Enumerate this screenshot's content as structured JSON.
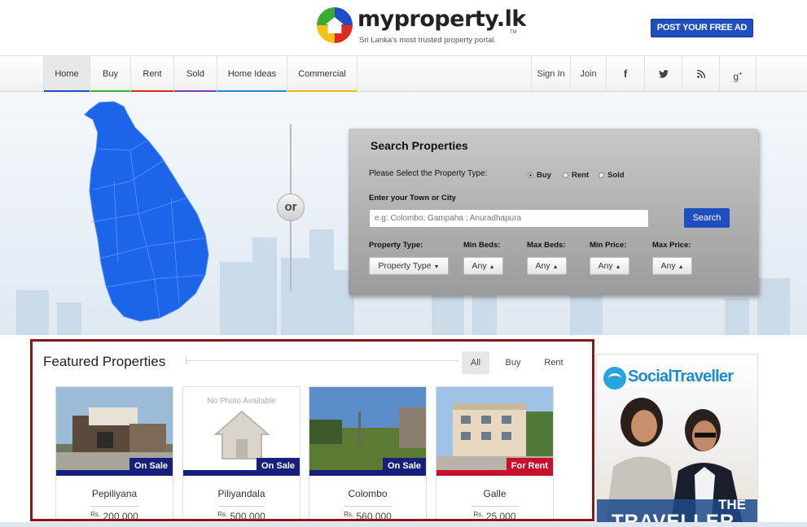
{
  "header": {
    "logo_text": "myproperty.lk",
    "logo_tm": "TM",
    "tagline": "Sri Lanka's most trusted property portal.",
    "post_ad_label": "POST YOUR FREE AD"
  },
  "nav": {
    "items": [
      {
        "label": "Home",
        "accent": "#1f4fbf"
      },
      {
        "label": "Buy",
        "accent": "#2bb24c"
      },
      {
        "label": "Rent",
        "accent": "#e02a1f"
      },
      {
        "label": "Sold",
        "accent": "#7b3fb5"
      },
      {
        "label": "Home Ideas",
        "accent": "#1f8fd4"
      },
      {
        "label": "Commercial",
        "accent": "#f2b41a"
      }
    ],
    "sign_in": "Sign In",
    "join": "Join",
    "social_icons": [
      "facebook-icon",
      "twitter-icon",
      "rss-icon",
      "google-plus-icon"
    ]
  },
  "hero": {
    "or_label": "or",
    "map_color": "#1c64ea"
  },
  "search": {
    "title": "Search Properties",
    "type_prompt": "Please Select the Property Type:",
    "options": [
      "Buy",
      "Rent",
      "Sold"
    ],
    "selected_option": "Buy",
    "town_label": "Enter your Town or City",
    "town_placeholder": "e.g: Colombo; Gampaha ; Anuradhapura",
    "search_button": "Search",
    "filters": [
      {
        "label": "Property Type:",
        "value": "Property Type"
      },
      {
        "label": "Min Beds:",
        "value": "Any"
      },
      {
        "label": "Max Beds:",
        "value": "Any"
      },
      {
        "label": "Min Price:",
        "value": "Any"
      },
      {
        "label": "Max Price:",
        "value": "Any"
      }
    ]
  },
  "featured": {
    "title": "Featured Properties",
    "tabs": [
      "All",
      "Buy",
      "Rent"
    ],
    "active_tab": "All",
    "no_photo_text": "No Photo Available",
    "cards": [
      {
        "location": "Pepiliyana",
        "badge": "On Sale",
        "badge_color": "#14207a",
        "currency": "Rs.",
        "price": "200,000"
      },
      {
        "location": "Piliyandala",
        "badge": "On Sale",
        "badge_color": "#14207a",
        "currency": "Rs.",
        "price": "500,000"
      },
      {
        "location": "Colombo",
        "badge": "On Sale",
        "badge_color": "#14207a",
        "currency": "Rs.",
        "price": "560,000"
      },
      {
        "location": "Galle",
        "badge": "For Rent",
        "badge_color": "#c8102e",
        "currency": "Rs.",
        "price": "25,000"
      }
    ]
  },
  "ad": {
    "brand": "SocialTraveller",
    "line1": "THE",
    "line2": "TRAVELLER"
  }
}
